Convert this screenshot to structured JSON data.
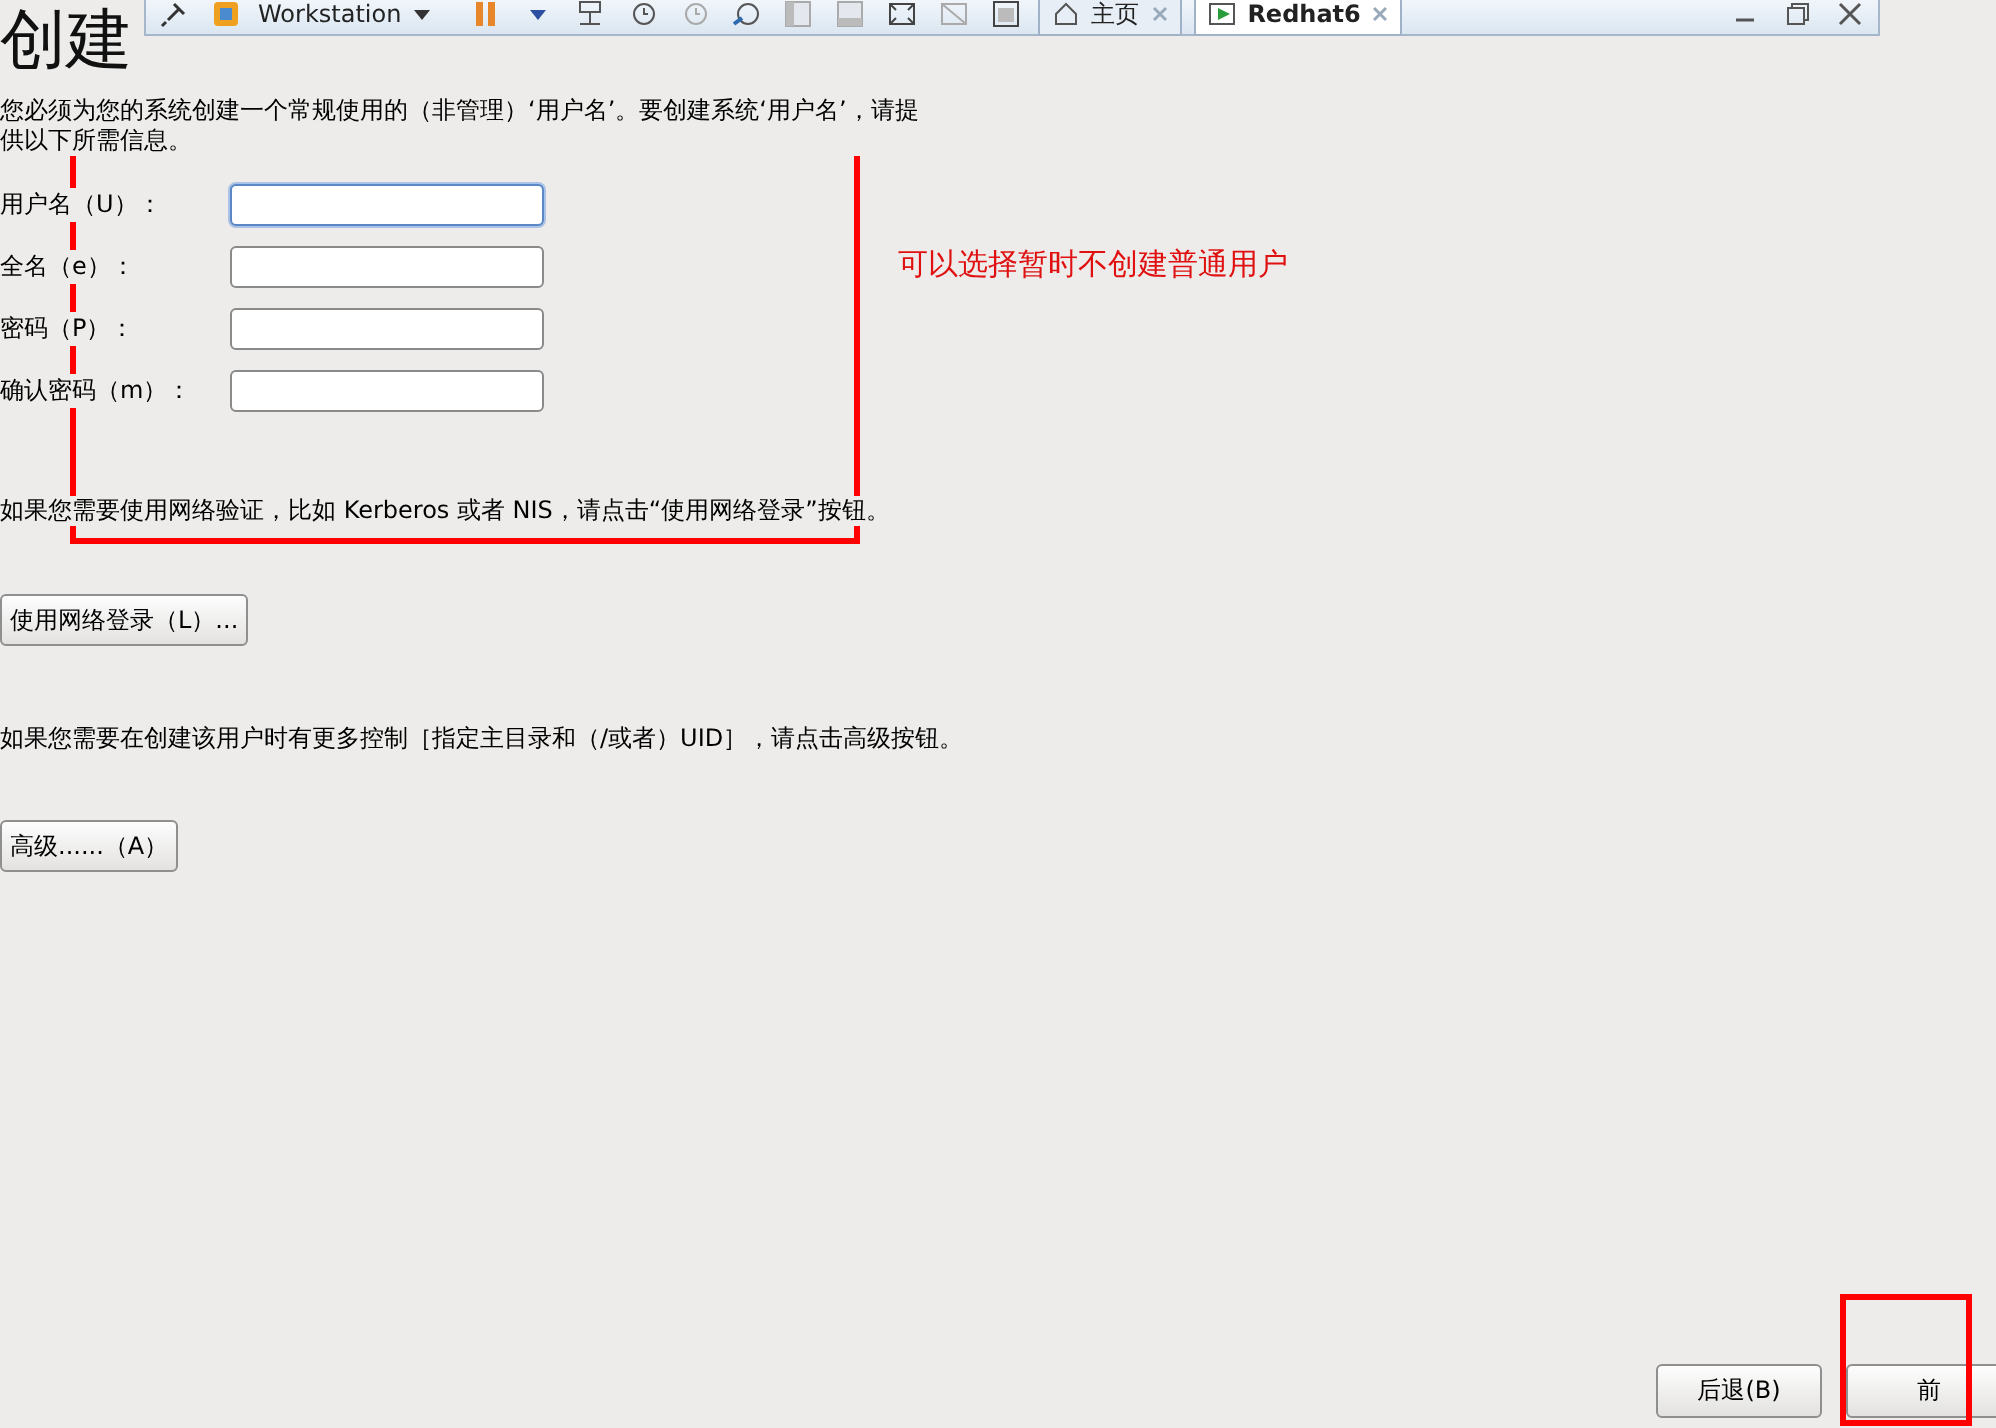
{
  "vm_toolbar": {
    "product": "Workstation",
    "tabs": [
      {
        "label": "主页",
        "selected": false
      },
      {
        "label": "Redhat6",
        "selected": true
      }
    ]
  },
  "title": "创建",
  "description": "您必须为您的系统创建一个常规使用的（非管理）‘用户名’。要创建系统‘用户名’，请提供以下所需信息。",
  "fields": [
    {
      "label": "用户名（U）：",
      "focused": true
    },
    {
      "label": "全名（e）：",
      "focused": false
    },
    {
      "label": "密码（P）：",
      "focused": false
    },
    {
      "label": "确认密码（m）：",
      "focused": false
    }
  ],
  "network_note": "如果您需要使用网络验证，比如 Kerberos 或者 NIS，请点击“使用网络登录”按钮。",
  "network_button": "使用网络登录（L）...",
  "advanced_note": "如果您需要在创建该用户时有更多控制［指定主目录和（/或者）UID］，请点击高级按钮。",
  "advanced_button": "高级......（A）",
  "nav_buttons": [
    "后退(B)",
    "前"
  ],
  "annotation": "可以选择暂时不创建普通用户"
}
